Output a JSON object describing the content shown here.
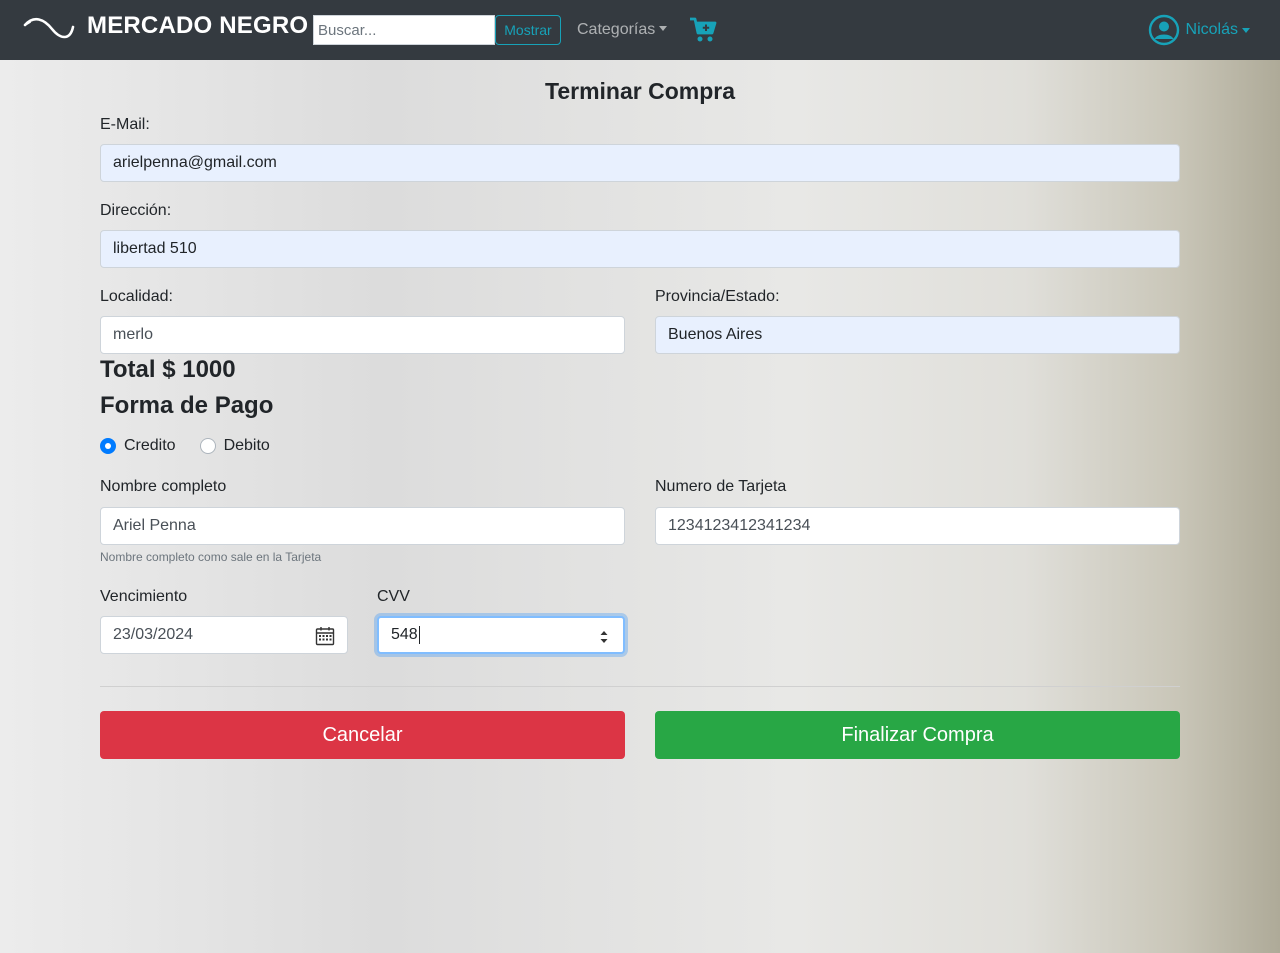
{
  "navbar": {
    "brand": "MERCADO NEGRO",
    "search_placeholder": "Buscar...",
    "search_button": "Mostrar",
    "categories": "Categorías",
    "user": "Nicolás"
  },
  "form": {
    "title": "Terminar Compra",
    "email_label": "E-Mail:",
    "email_value": "arielpenna@gmail.com",
    "address_label": "Dirección:",
    "address_value": "libertad 510",
    "city_label": "Localidad:",
    "city_value": "merlo",
    "province_label": "Provincia/Estado:",
    "province_value": "Buenos Aires",
    "total": "Total $ 1000",
    "payment_heading": "Forma de Pago",
    "payment_options": [
      "Credito",
      "Debito"
    ],
    "payment_selected": "Credito",
    "fullname_label": "Nombre completo",
    "fullname_value": "Ariel Penna",
    "fullname_help": "Nombre completo como sale en la Tarjeta",
    "card_label": "Numero de Tarjeta",
    "card_value": "1234123412341234",
    "expiry_label": "Vencimiento",
    "expiry_value": "23/03/2024",
    "cvv_label": "CVV",
    "cvv_value": "548",
    "cancel_button": "Cancelar",
    "finish_button": "Finalizar Compra"
  },
  "colors": {
    "navbar": "#343a40",
    "accent": "#17a2b8",
    "radio_checked": "#007bff",
    "cancel": "#dc3545",
    "finish": "#28a745",
    "autofill": "#e8f0fe"
  },
  "icons": {
    "logo": "whip-logo-icon",
    "cart": "cart-plus-icon",
    "user": "user-circle-icon",
    "calendar": "calendar-icon"
  }
}
